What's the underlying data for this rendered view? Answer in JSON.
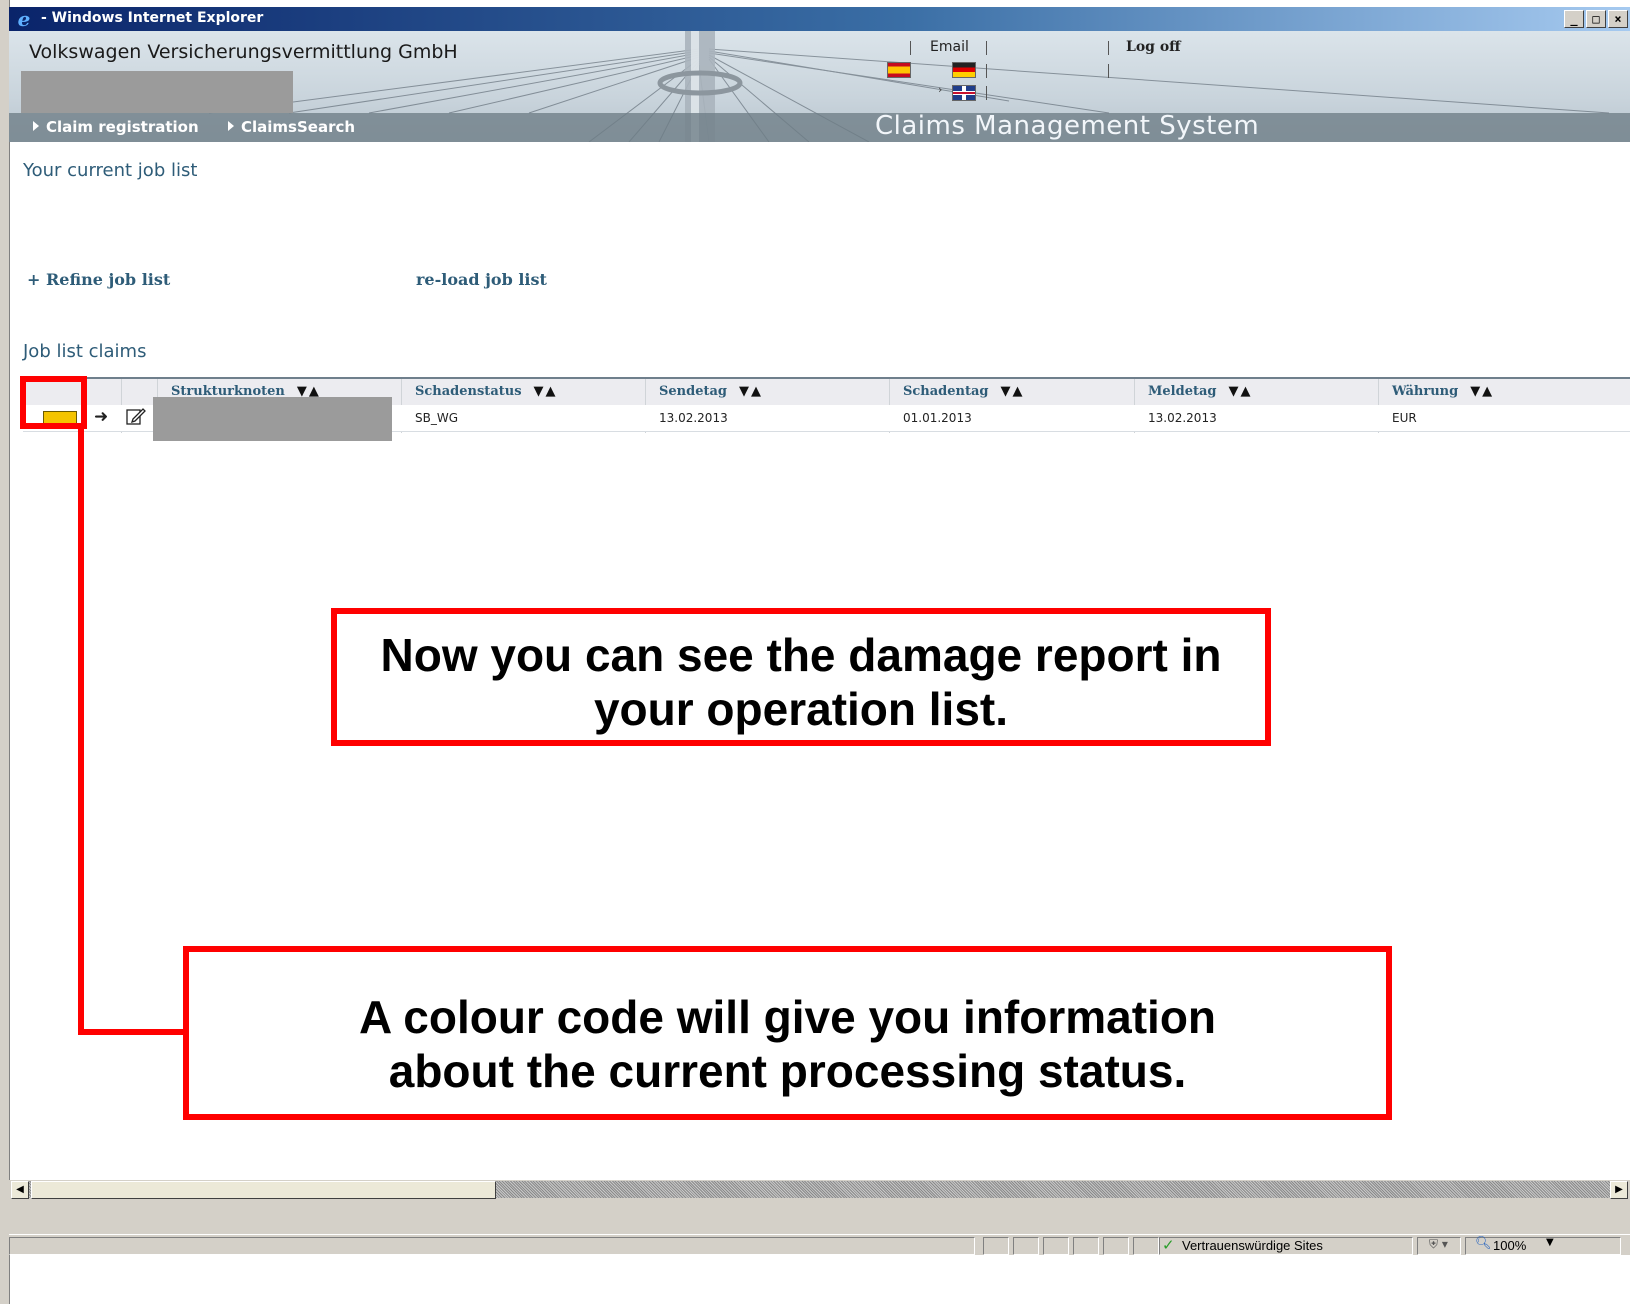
{
  "window": {
    "title": "- Windows Internet Explorer",
    "controls": [
      "_",
      "□",
      "×"
    ]
  },
  "header": {
    "company": "Volkswagen Versicherungsvermittlung GmbH",
    "email_label": "Email",
    "logoff_label": "Log off",
    "system_title": "Claims Management System",
    "nav": [
      {
        "label": "Claim registration"
      },
      {
        "label": "ClaimsSearch"
      }
    ],
    "languages": [
      "es-flag",
      "de-flag",
      "gb-flag"
    ]
  },
  "content": {
    "current_job_title": "Your current job list",
    "refine_label": "+ Refine job list",
    "reload_label": "re-load job list",
    "job_list_title": "Job list claims"
  },
  "table": {
    "columns": [
      "Strukturknoten",
      "Schadenstatus",
      "Sendetag",
      "Schadentag",
      "Meldetag",
      "Währung"
    ],
    "sort_glyph": "▼▲",
    "rows": [
      {
        "status_color": "#f4c400",
        "strukturknoten": "",
        "schadenstatus": "SB_WG",
        "sendetag": "13.02.2013",
        "schadentag": "01.01.2013",
        "meldetag": "13.02.2013",
        "waehrung": "EUR"
      }
    ]
  },
  "callouts": {
    "first_line1": "Now you can see the damage report in",
    "first_line2": "your operation list.",
    "second_line1": "A colour code will give you information",
    "second_line2": "about the current processing status."
  },
  "statusbar": {
    "zone": "Vertrauenswürdige Sites",
    "zoom": "100%"
  },
  "colors": {
    "accent_red": "#ff0000",
    "link_blue": "#2e5c78",
    "status_yellow": "#f4c400"
  }
}
